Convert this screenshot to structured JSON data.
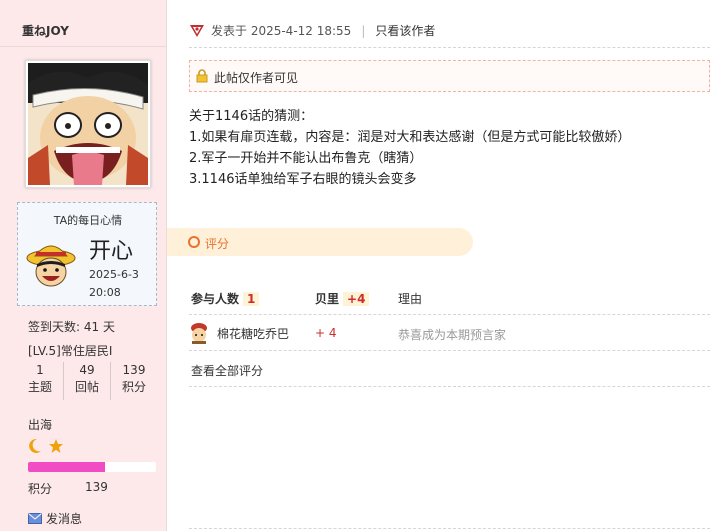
{
  "sidebar": {
    "username": "重ねJOY",
    "mood": {
      "title": "TA的每日心情",
      "text": "开心",
      "date": "2025-6-3",
      "time": "20:08"
    },
    "checkin": "签到天数: 41 天",
    "level": "[LV.5]常住居民I",
    "stats": [
      {
        "value": "1",
        "label": "主题"
      },
      {
        "value": "49",
        "label": "回帖"
      },
      {
        "value": "139",
        "label": "积分"
      }
    ],
    "realm": "出海",
    "points_label": "积分",
    "points_value": "139",
    "points_progress": 0.6,
    "message": "发消息"
  },
  "post": {
    "posted_at": "发表于 2025-4-12 18:55",
    "only_author": "只看该作者",
    "locked_notice": "此帖仅作者可见",
    "lines": [
      "关于1146话的猜测：",
      "1.如果有扉页连载，内容是：润是对大和表达感谢（但是方式可能比较傲娇）",
      "2.军子一开始并不能认出布鲁克（瞎猜）",
      "3.1146话单独给军子右眼的镜头会变多"
    ]
  },
  "rating": {
    "tab_label": "评分",
    "participants_label": "参与人数",
    "participants_count": "1",
    "shell_label": "贝里",
    "shell_total": "+4",
    "reason_label": "理由",
    "entries": [
      {
        "user": "棉花糖吃乔巴",
        "score": "+ 4",
        "reason": "恭喜成为本期预言家"
      }
    ],
    "view_all": "查看全部评分"
  },
  "colors": {
    "sidebar_bg": "#fde9ea",
    "accent_orange": "#e8732b",
    "score_red": "#d12b2b",
    "progress": "#f24cc4"
  }
}
